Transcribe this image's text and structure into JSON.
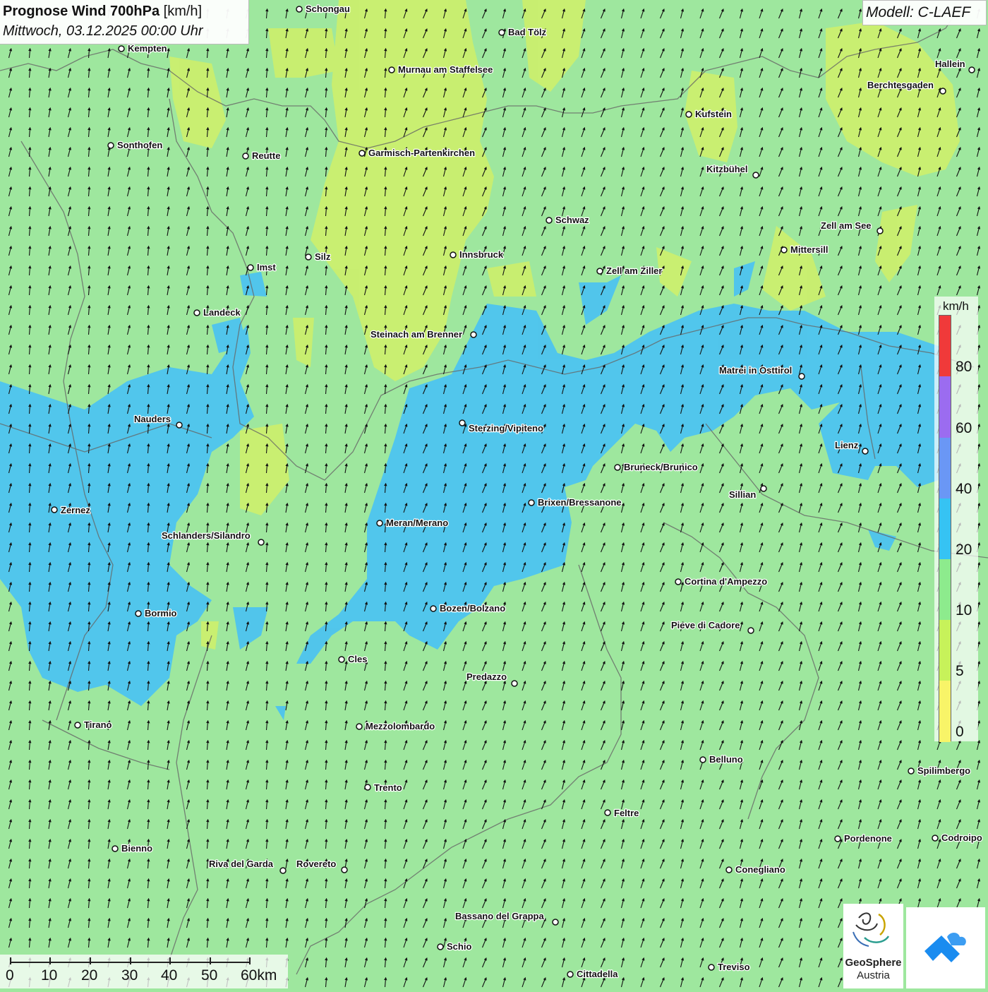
{
  "header": {
    "title_bold": "Prognose Wind 700hPa",
    "title_unit": "[km/h]",
    "subtitle": "Mittwoch, 03.12.2025 00:00 Uhr",
    "model": "Modell: C-LAEF"
  },
  "legend": {
    "unit": "km/h",
    "ticks": [
      "80",
      "60",
      "40",
      "20",
      "10",
      "5",
      "0"
    ],
    "colors": [
      "#f03a3a",
      "#9b6cf0",
      "#6a97f5",
      "#36c3f3",
      "#8deb8d",
      "#c7f25a",
      "#f8f468"
    ]
  },
  "scale_bar": {
    "labels": [
      "0",
      "10",
      "20",
      "30",
      "40",
      "50",
      "60km"
    ]
  },
  "logos": {
    "geosphere_line1": "GeoSphere",
    "geosphere_line2": "Austria"
  },
  "cities": [
    "Schongau",
    "Bad Tölz",
    "Kempten",
    "Murnau am Staffelsee",
    "Hallein",
    "Berchtesgaden",
    "Kufstein",
    "Sonthofen",
    "Reutte",
    "Garmisch-Partenkirchen",
    "Kitzbühel",
    "Schwaz",
    "Zell am See",
    "Mittersill",
    "Innsbruck",
    "Silz",
    "Imst",
    "Zell am Ziller",
    "Landeck",
    "Steinach am Brenner",
    "Matrei in Osttirol",
    "Nauders",
    "Sterzing/Vipiteno",
    "Lienz",
    "Bruneck/Brunico",
    "Sillian",
    "Zernez",
    "Brixen/Bressanone",
    "Meran/Merano",
    "Schlanders/Silandro",
    "Cortina d'Ampezzo",
    "Bormio",
    "Bozen/Bolzano",
    "Pieve di Cadore",
    "Cles",
    "Predazzo",
    "Tirano",
    "Mezzolombardo",
    "Belluno",
    "Spilimbergo",
    "Trento",
    "Feltre",
    "Bienno",
    "Pordenone",
    "Codroipo",
    "Riva del Garda",
    "Rovereto",
    "Conegliano",
    "Bassano del Grappa",
    "Schio",
    "Treviso",
    "Cittadella"
  ]
}
